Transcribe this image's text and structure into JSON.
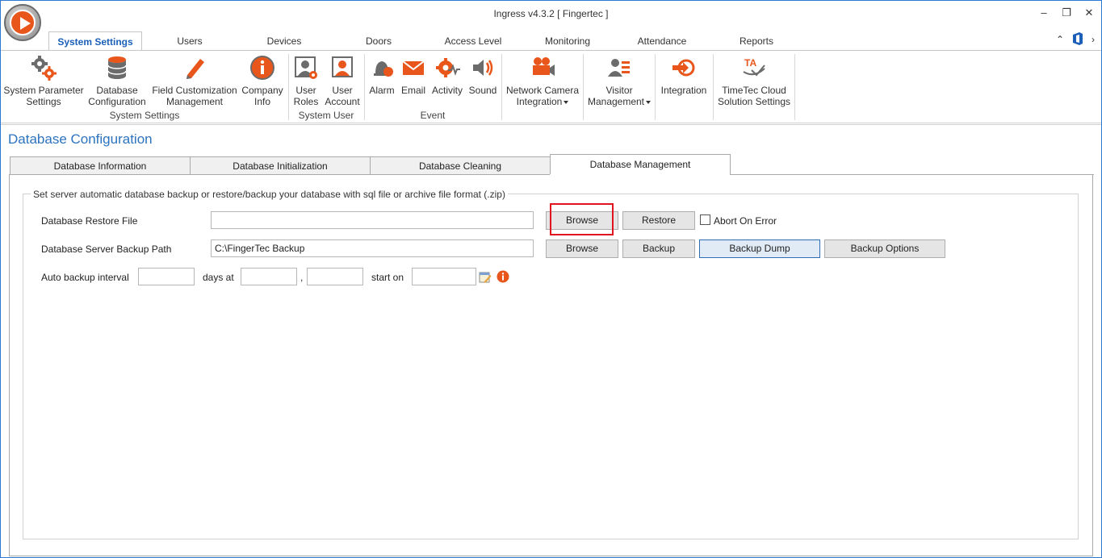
{
  "window": {
    "title": "Ingress v4.3.2 [ Fingertec ]"
  },
  "ribbon": {
    "tabs": [
      "System Settings",
      "Users",
      "Devices",
      "Doors",
      "Access Level",
      "Monitoring",
      "Attendance",
      "Reports"
    ],
    "active_tab": "System Settings",
    "buttons": {
      "system_parameter": [
        "System Parameter",
        "Settings"
      ],
      "database_config": [
        "Database",
        "Configuration"
      ],
      "field_customization": [
        "Field Customization",
        "Management"
      ],
      "company_info": [
        "Company",
        "Info"
      ],
      "user_roles": [
        "User",
        "Roles"
      ],
      "user_account": [
        "User",
        "Account"
      ],
      "alarm": "Alarm",
      "email": "Email",
      "activity": "Activity",
      "sound": "Sound",
      "network_camera": [
        "Network Camera",
        "Integration"
      ],
      "visitor_mgmt": [
        "Visitor",
        "Management"
      ],
      "integration": "Integration",
      "timetec_cloud": [
        "TimeTec Cloud",
        "Solution Settings"
      ]
    },
    "groups": {
      "system_settings": "System Settings",
      "system_user": "System User",
      "event": "Event"
    }
  },
  "page": {
    "title": "Database Configuration",
    "tabs": [
      "Database Information",
      "Database Initialization",
      "Database Cleaning",
      "Database Management"
    ],
    "active_tab": "Database Management",
    "group_legend": "Set server automatic database backup or restore/backup your database with sql file or archive file format (.zip)",
    "restore": {
      "label": "Database Restore File",
      "value": "",
      "browse": "Browse",
      "restore": "Restore",
      "abort_label": "Abort On Error",
      "abort_checked": false
    },
    "backup": {
      "label": "Database Server Backup Path",
      "value": "C:\\FingerTec Backup",
      "browse": "Browse",
      "backup": "Backup",
      "backup_dump": "Backup Dump",
      "backup_options": "Backup Options"
    },
    "auto": {
      "label": "Auto backup interval",
      "interval": "",
      "days_at": "days at",
      "hour": "",
      "comma": ",",
      "minute": "",
      "start_on": "start on",
      "start_date": ""
    }
  },
  "colors": {
    "accent": "#2c73bf",
    "ribbon_icon": "#e8561b",
    "highlight": "#e0141e"
  }
}
